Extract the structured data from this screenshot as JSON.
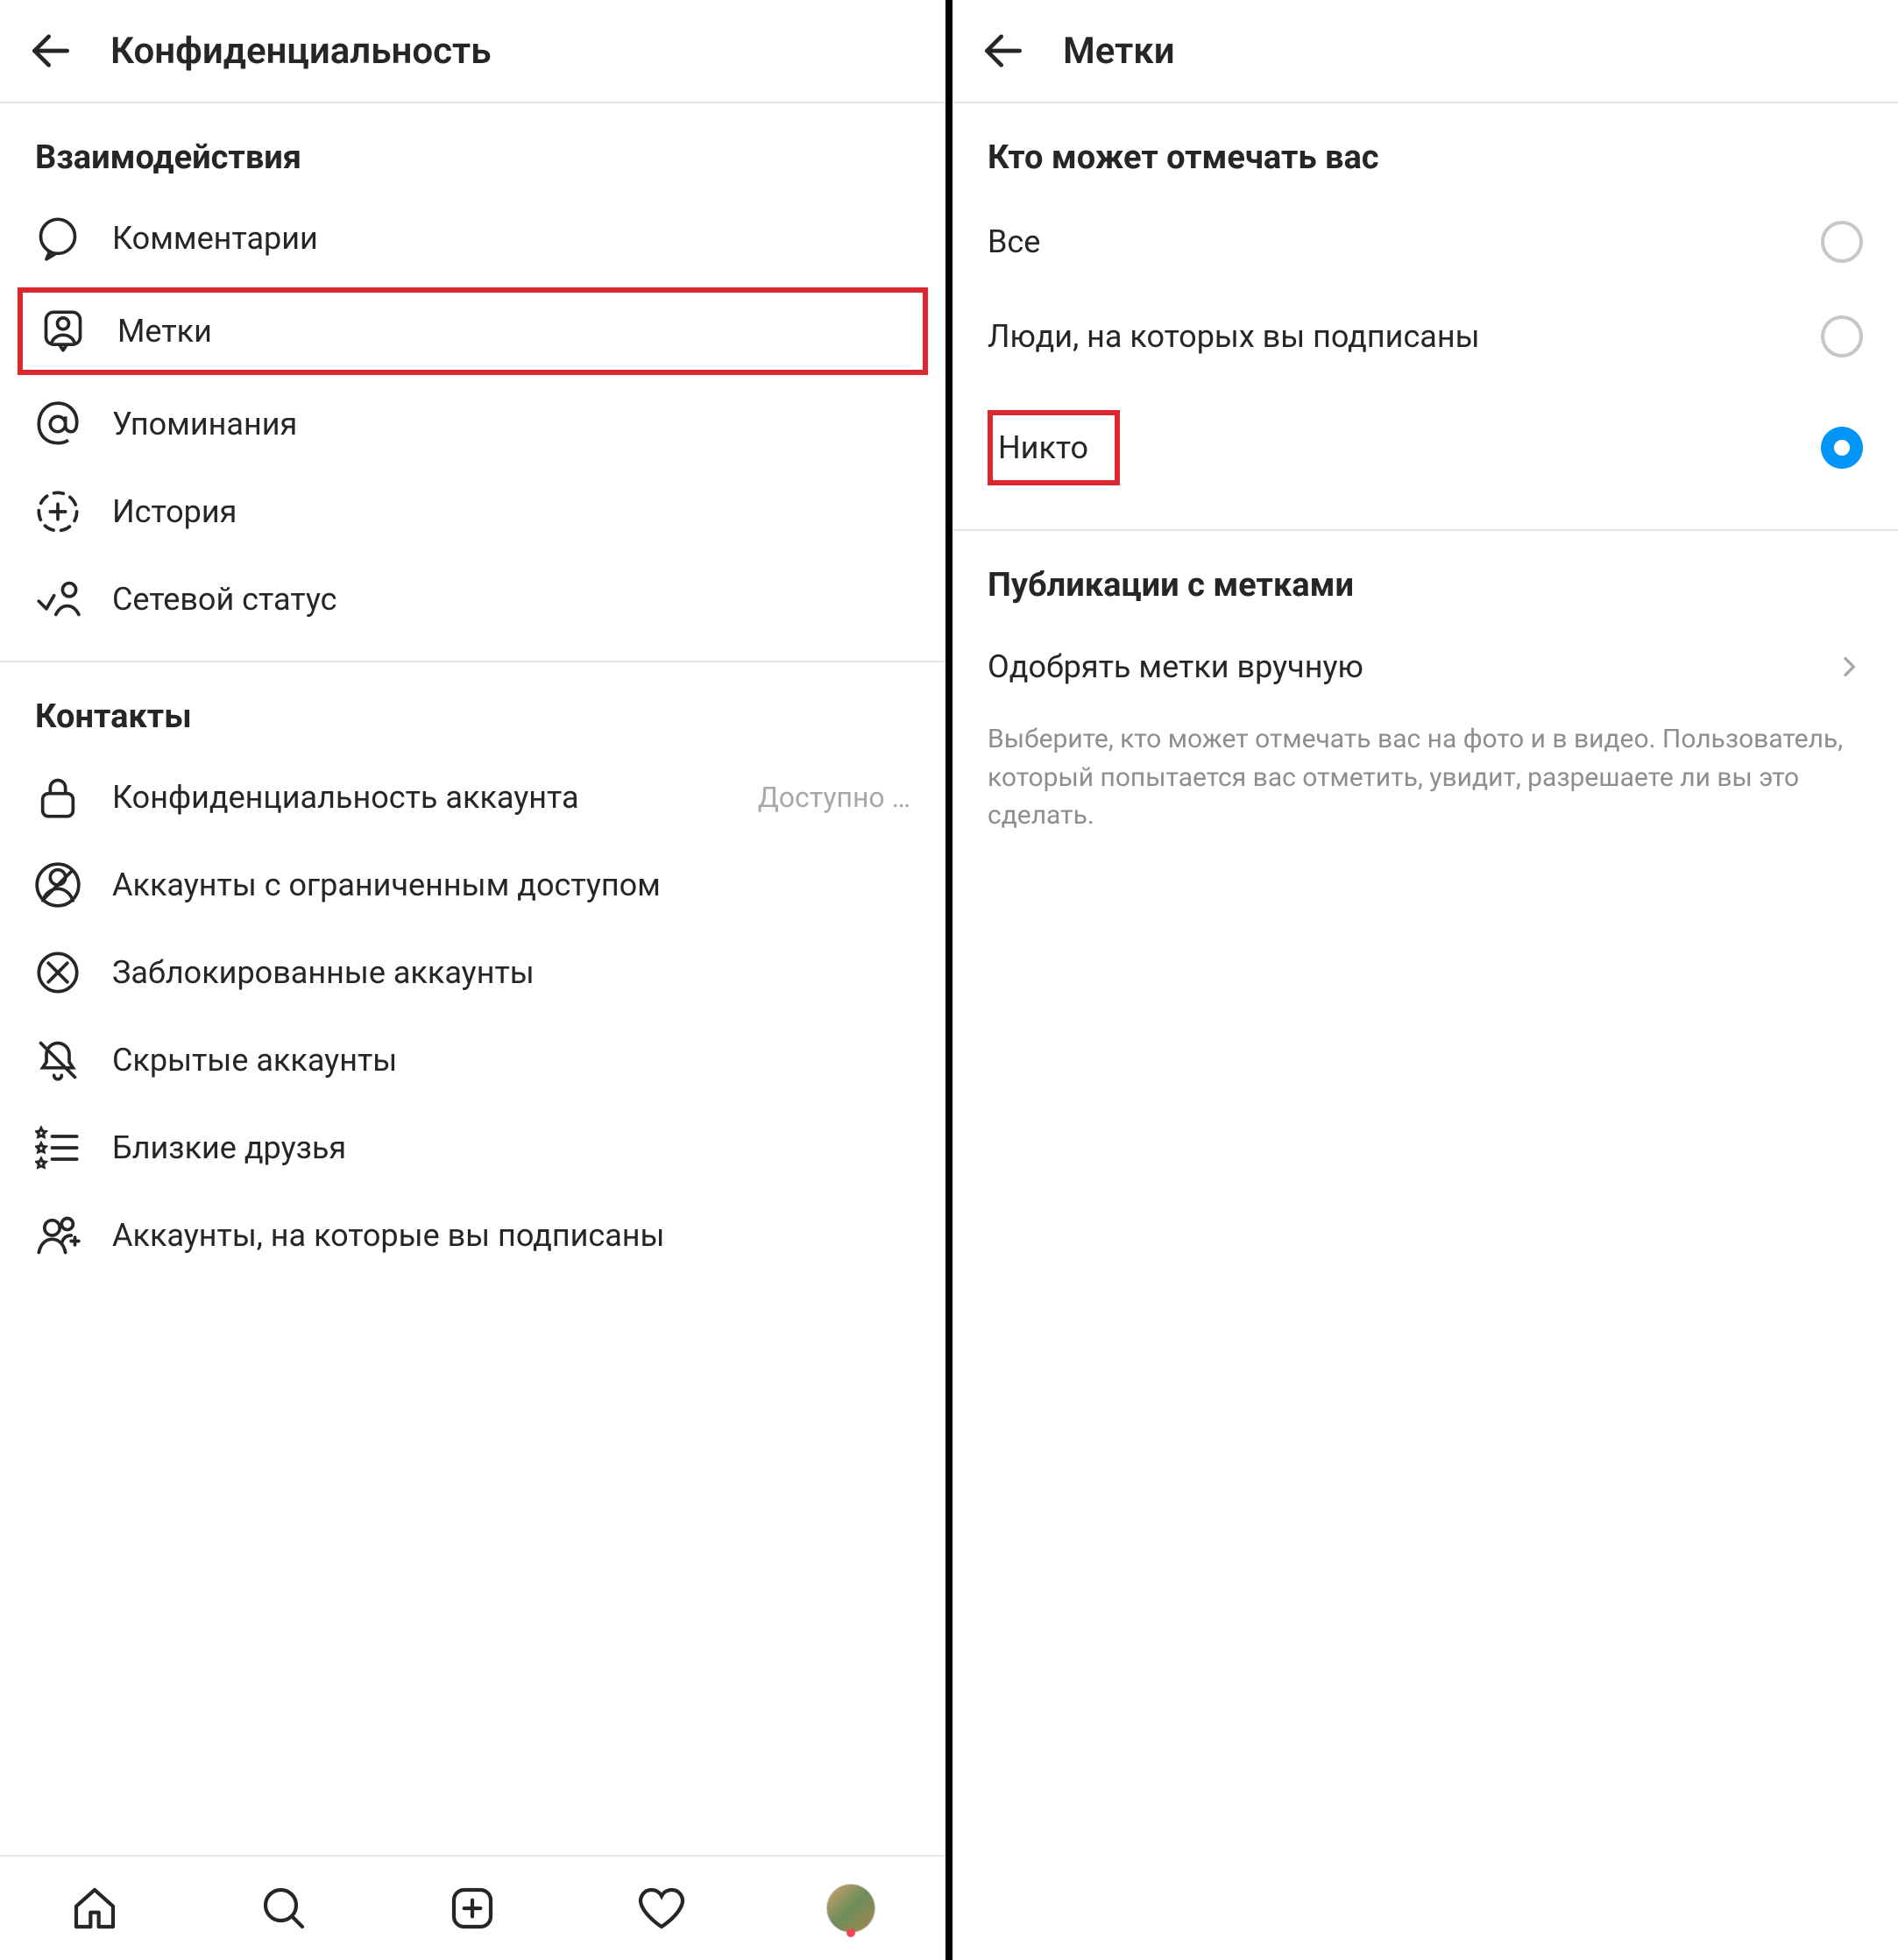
{
  "left": {
    "header": {
      "title": "Конфиденциальность"
    },
    "section1": {
      "title": "Взаимодействия",
      "items": [
        {
          "label": "Комментарии"
        },
        {
          "label": "Метки",
          "highlighted": true
        },
        {
          "label": "Упоминания"
        },
        {
          "label": "История"
        },
        {
          "label": "Сетевой статус"
        }
      ]
    },
    "section2": {
      "title": "Контакты",
      "items": [
        {
          "label": "Конфиденциальность аккаунта",
          "suffix": "Доступно …"
        },
        {
          "label": "Аккаунты с ограниченным доступом"
        },
        {
          "label": "Заблокированные аккаунты"
        },
        {
          "label": "Скрытые аккаунты"
        },
        {
          "label": "Близкие друзья"
        },
        {
          "label": "Аккаунты, на которые вы подписаны"
        }
      ]
    }
  },
  "right": {
    "header": {
      "title": "Метки"
    },
    "section1": {
      "title": "Кто может отмечать вас",
      "options": [
        {
          "label": "Все",
          "selected": false
        },
        {
          "label": "Люди, на которых вы подписаны",
          "selected": false
        },
        {
          "label": "Никто",
          "selected": true,
          "highlighted": true
        }
      ]
    },
    "section2": {
      "title": "Публикации с метками",
      "nav": {
        "label": "Одобрять метки вручную"
      },
      "help": "Выберите, кто может отмечать вас на фото и в видео. Пользователь, который попытается вас отметить, увидит, разрешаете ли вы это сделать."
    }
  }
}
